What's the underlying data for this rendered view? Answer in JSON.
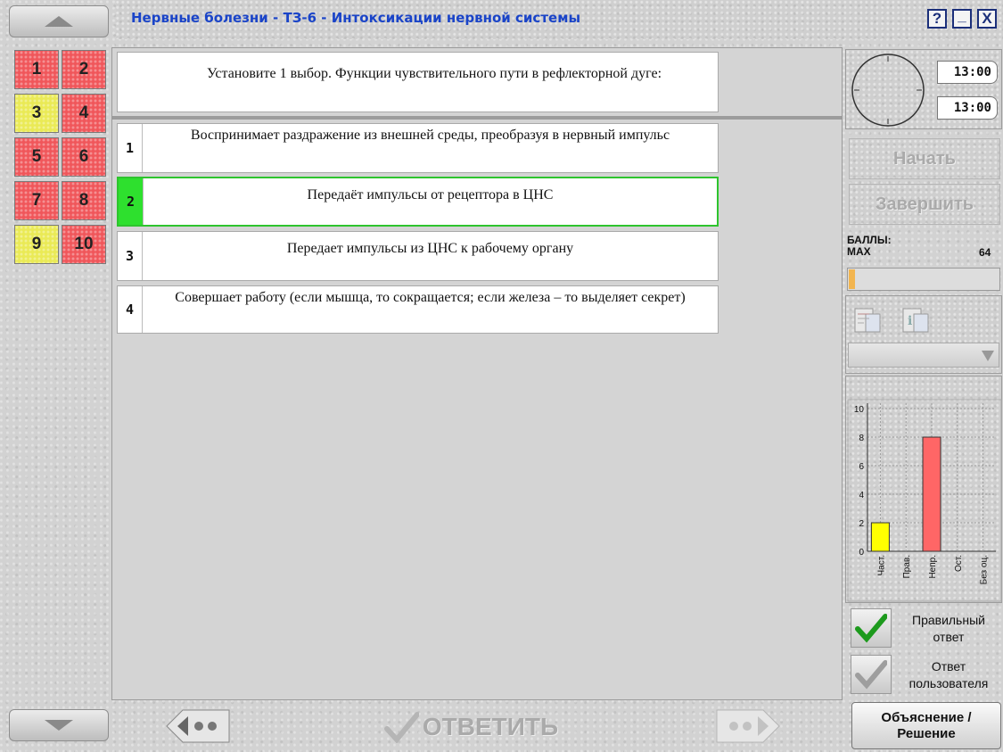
{
  "window": {
    "title": "Нервные болезни - ТЗ-6 - Интоксикации нервной системы",
    "help_label": "?",
    "minimize_label": "_",
    "close_label": "X"
  },
  "nav": {
    "questions": [
      {
        "label": "1",
        "status": "red"
      },
      {
        "label": "2",
        "status": "red"
      },
      {
        "label": "3",
        "status": "yellow"
      },
      {
        "label": "4",
        "status": "red"
      },
      {
        "label": "5",
        "status": "red"
      },
      {
        "label": "6",
        "status": "red"
      },
      {
        "label": "7",
        "status": "red"
      },
      {
        "label": "8",
        "status": "red"
      },
      {
        "label": "9",
        "status": "yellow"
      },
      {
        "label": "10",
        "status": "red"
      }
    ]
  },
  "question": {
    "text": "Установите 1 выбор. Функции чувствительного пути в рефлекторной дуге:"
  },
  "answers": [
    {
      "num": "1",
      "text": "Воспринимает раздражение из внешней среды, преобразуя в нервный импульс",
      "selected": false
    },
    {
      "num": "2",
      "text": "Передаёт импульсы от рецептора в ЦНС",
      "selected": true
    },
    {
      "num": "3",
      "text": "Передает импульсы из ЦНС к рабочему органу",
      "selected": false
    },
    {
      "num": "4",
      "text": "Совершает работу (если мышца, то сокращается; если железа – то выделяет секрет)",
      "selected": false
    }
  ],
  "timer": {
    "time_total": "13:00",
    "time_left": "13:00"
  },
  "controls": {
    "start_label": "Начать",
    "finish_label": "Завершить"
  },
  "score": {
    "label": "БАЛЛЫ:",
    "max_label": "MAX",
    "max_value": "64",
    "progress": 0.04,
    "progress_color": "#f2b550"
  },
  "chart_data": {
    "type": "bar",
    "categories": [
      "Част.",
      "Прав.",
      "Непр.",
      "Ост.",
      "Без оц."
    ],
    "values": [
      2,
      0,
      8,
      0,
      0
    ],
    "colors": [
      "#ffff00",
      "#ff6666",
      "#ff6666",
      "#ff6666",
      "#ff6666"
    ],
    "ylim": [
      0,
      10
    ],
    "yticks": [
      "0",
      "2",
      "4",
      "6",
      "8",
      "10"
    ],
    "grid": true
  },
  "verdict": {
    "correct_label_1": "Правильный",
    "correct_label_2": "ответ",
    "user_label_1": "Ответ",
    "user_label_2": "пользователя"
  },
  "bottom": {
    "answer_label": "ОТВЕТИТЬ",
    "explain_label_1": "Объяснение /",
    "explain_label_2": "Решение"
  },
  "colors": {
    "title": "#1a44c8",
    "selected_border": "#2ec42e",
    "question_red": "#f0565a",
    "question_yellow": "#eaea55"
  }
}
